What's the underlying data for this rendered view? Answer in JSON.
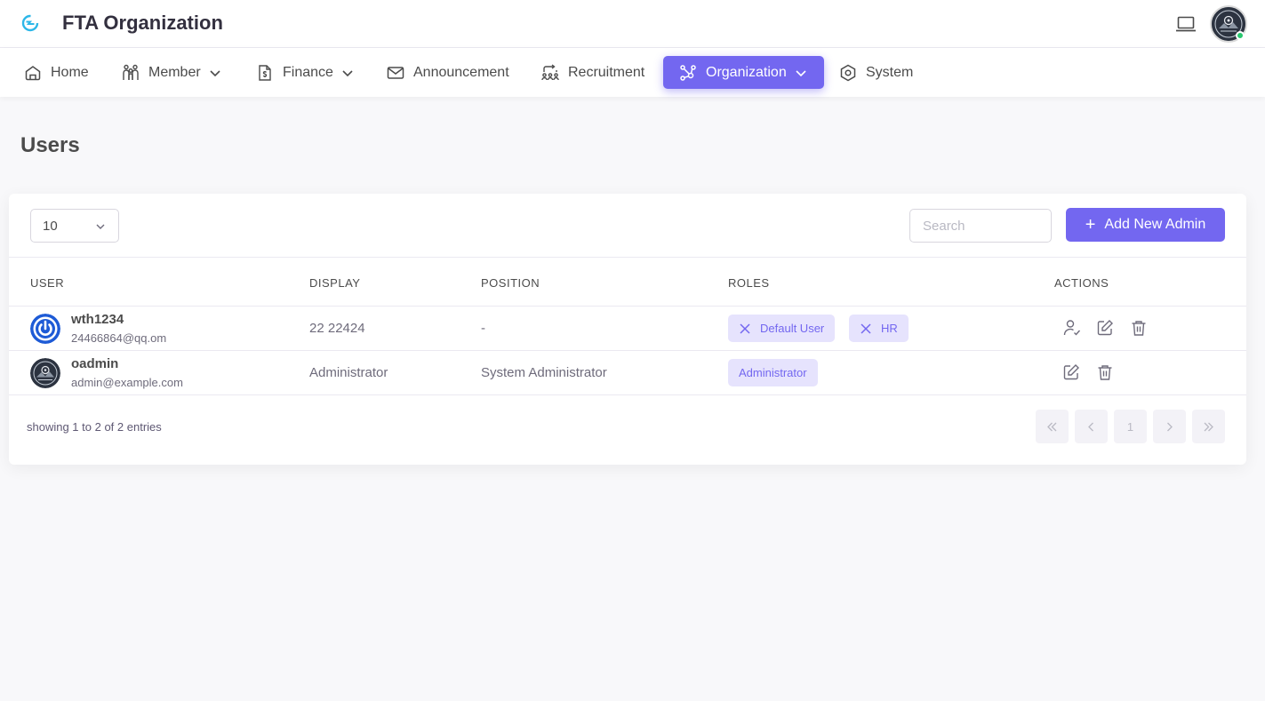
{
  "app": {
    "title": "FTA Organization"
  },
  "nav": {
    "items": [
      {
        "label": "Home",
        "icon": "home-icon"
      },
      {
        "label": "Member",
        "icon": "users-icon",
        "dropdown": true
      },
      {
        "label": "Finance",
        "icon": "file-dollar-icon",
        "dropdown": true
      },
      {
        "label": "Announcement",
        "icon": "mail-icon"
      },
      {
        "label": "Recruitment",
        "icon": "recruitment-icon"
      },
      {
        "label": "Organization",
        "icon": "network-icon",
        "dropdown": true,
        "active": true
      },
      {
        "label": "System",
        "icon": "hexagon-settings-icon"
      }
    ]
  },
  "page": {
    "title": "Users"
  },
  "toolbar": {
    "per_page_value": "10",
    "search_placeholder": "Search",
    "add_button_label": "Add New Admin"
  },
  "table": {
    "columns": [
      "USER",
      "DISPLAY",
      "POSITION",
      "ROLES",
      "ACTIONS"
    ],
    "rows": [
      {
        "username": "wth1234",
        "email": "24466864@qq.om",
        "display": "22 22424",
        "position": "-",
        "roles": [
          "Default User",
          "HR"
        ],
        "roles_removable": true,
        "actions": [
          "assign-user-icon",
          "edit-icon",
          "delete-icon"
        ]
      },
      {
        "username": "oadmin",
        "email": "admin@example.com",
        "display": "Administrator",
        "position": "System Administrator",
        "roles": [
          "Administrator"
        ],
        "roles_removable": false,
        "actions": [
          "edit-icon",
          "delete-icon"
        ]
      }
    ]
  },
  "footer": {
    "showing_text": "showing 1 to 2 of 2 entries",
    "current_page": "1"
  },
  "colors": {
    "primary": "#7367f0",
    "badge_bg": "#e6e3fd",
    "online": "#28c76f",
    "logo": "#2db7e8"
  }
}
